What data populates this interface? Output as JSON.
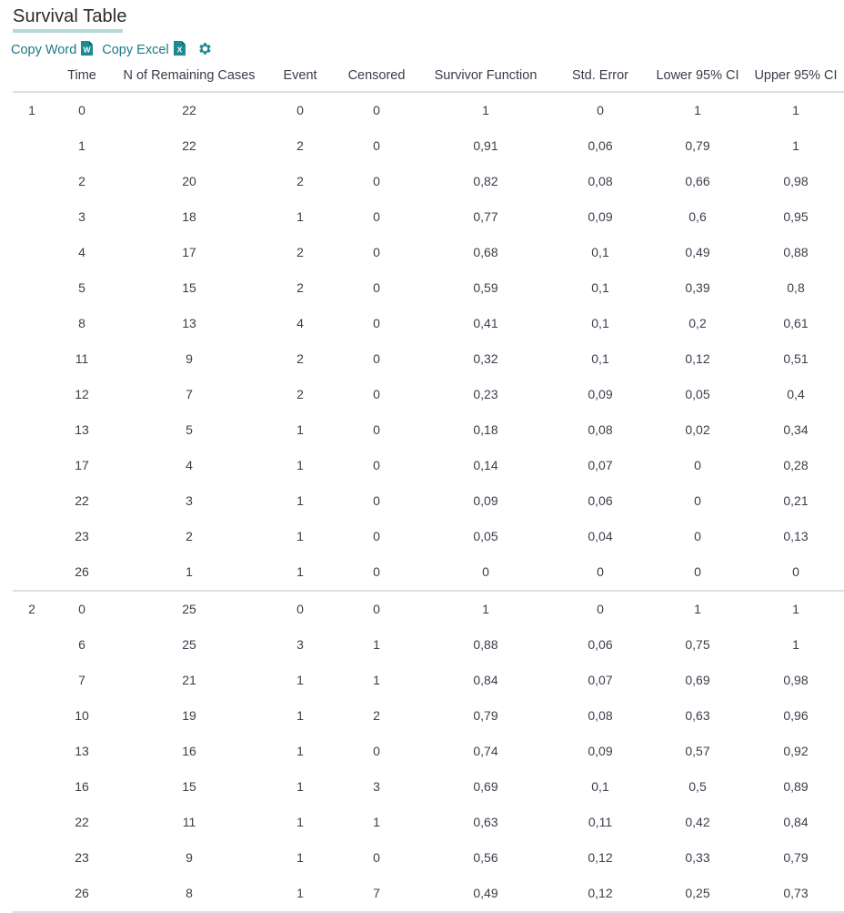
{
  "page": {
    "title": "Survival Table"
  },
  "toolbar": {
    "copy_word_label": "Copy Word",
    "copy_excel_label": "Copy Excel",
    "word_icon": "word-document-icon",
    "excel_icon": "excel-document-icon",
    "settings_icon": "gear-icon",
    "link_color": "#1b7b84",
    "icon_color": "#1b8a92"
  },
  "table": {
    "columns": [
      "",
      "Time",
      "N of Remaining Cases",
      "Event",
      "Censored",
      "Survivor Function",
      "Std. Error",
      "Lower 95% CI",
      "Upper 95% CI"
    ],
    "groups": [
      {
        "index": "1",
        "rows": [
          [
            "0",
            "22",
            "0",
            "0",
            "1",
            "0",
            "1",
            "1"
          ],
          [
            "1",
            "22",
            "2",
            "0",
            "0,91",
            "0,06",
            "0,79",
            "1"
          ],
          [
            "2",
            "20",
            "2",
            "0",
            "0,82",
            "0,08",
            "0,66",
            "0,98"
          ],
          [
            "3",
            "18",
            "1",
            "0",
            "0,77",
            "0,09",
            "0,6",
            "0,95"
          ],
          [
            "4",
            "17",
            "2",
            "0",
            "0,68",
            "0,1",
            "0,49",
            "0,88"
          ],
          [
            "5",
            "15",
            "2",
            "0",
            "0,59",
            "0,1",
            "0,39",
            "0,8"
          ],
          [
            "8",
            "13",
            "4",
            "0",
            "0,41",
            "0,1",
            "0,2",
            "0,61"
          ],
          [
            "11",
            "9",
            "2",
            "0",
            "0,32",
            "0,1",
            "0,12",
            "0,51"
          ],
          [
            "12",
            "7",
            "2",
            "0",
            "0,23",
            "0,09",
            "0,05",
            "0,4"
          ],
          [
            "13",
            "5",
            "1",
            "0",
            "0,18",
            "0,08",
            "0,02",
            "0,34"
          ],
          [
            "17",
            "4",
            "1",
            "0",
            "0,14",
            "0,07",
            "0",
            "0,28"
          ],
          [
            "22",
            "3",
            "1",
            "0",
            "0,09",
            "0,06",
            "0",
            "0,21"
          ],
          [
            "23",
            "2",
            "1",
            "0",
            "0,05",
            "0,04",
            "0",
            "0,13"
          ],
          [
            "26",
            "1",
            "1",
            "0",
            "0",
            "0",
            "0",
            "0"
          ]
        ]
      },
      {
        "index": "2",
        "rows": [
          [
            "0",
            "25",
            "0",
            "0",
            "1",
            "0",
            "1",
            "1"
          ],
          [
            "6",
            "25",
            "3",
            "1",
            "0,88",
            "0,06",
            "0,75",
            "1"
          ],
          [
            "7",
            "21",
            "1",
            "1",
            "0,84",
            "0,07",
            "0,69",
            "0,98"
          ],
          [
            "10",
            "19",
            "1",
            "2",
            "0,79",
            "0,08",
            "0,63",
            "0,96"
          ],
          [
            "13",
            "16",
            "1",
            "0",
            "0,74",
            "0,09",
            "0,57",
            "0,92"
          ],
          [
            "16",
            "15",
            "1",
            "3",
            "0,69",
            "0,1",
            "0,5",
            "0,89"
          ],
          [
            "22",
            "11",
            "1",
            "1",
            "0,63",
            "0,11",
            "0,42",
            "0,84"
          ],
          [
            "23",
            "9",
            "1",
            "0",
            "0,56",
            "0,12",
            "0,33",
            "0,79"
          ],
          [
            "26",
            "8",
            "1",
            "7",
            "0,49",
            "0,12",
            "0,25",
            "0,73"
          ]
        ]
      }
    ]
  }
}
